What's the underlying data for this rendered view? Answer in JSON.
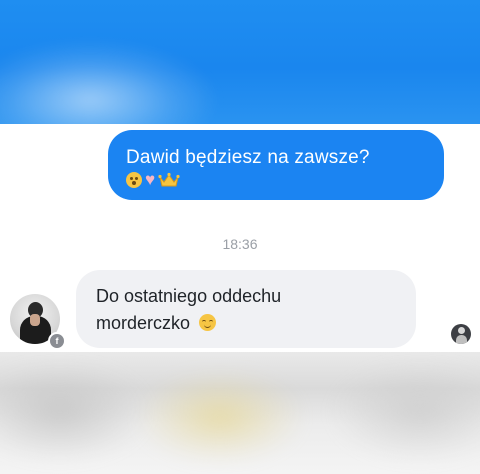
{
  "colors": {
    "header_blue": "#1f8ef1",
    "outgoing_bubble": "#1b84f2",
    "incoming_bubble": "#f0f1f4",
    "timestamp_gray": "#9a9fa6"
  },
  "conversation": {
    "outgoing_message": {
      "text": "Dawid będziesz na zawsze?",
      "emojis": [
        "astonished-face-emoji",
        "pink-heart-emoji",
        "crown-emoji"
      ]
    },
    "timestamp": "18:36",
    "incoming_message": {
      "line1": "Do ostatniego oddechu",
      "line2": "morderczko",
      "emoji": "relieved-face-emoji"
    }
  },
  "icons": {
    "messenger_badge": "f",
    "heart": "♥"
  }
}
